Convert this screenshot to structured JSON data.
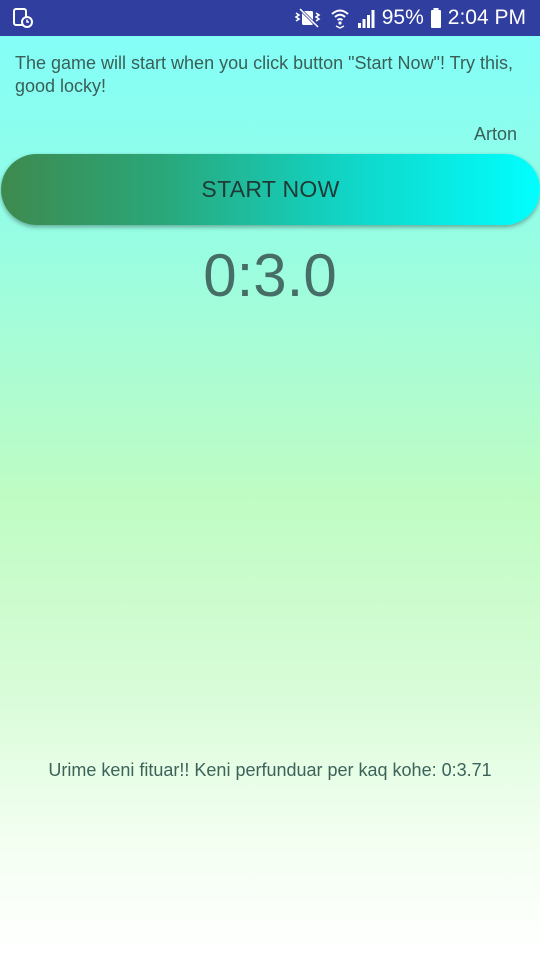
{
  "status_bar": {
    "battery_percent": "95%",
    "time": "2:04 PM",
    "icons": [
      "screenshot-notification-icon",
      "mute-vibrate-icon",
      "wifi-icon",
      "signal-icon",
      "battery-icon"
    ]
  },
  "intro_text": "The game will start when you click button \"Start Now\"! Try this, good locky!",
  "author": "Arton",
  "start_button_label": "START NOW",
  "timer_display": "0:3.0",
  "result_text": "Urime keni fituar!! Keni perfunduar per kaq kohe: 0:3.71",
  "colors": {
    "status_bar": "#303f9f",
    "button_gradient_start": "#3e8a4e",
    "button_gradient_end": "#00ffff",
    "text": "#3a5f58"
  }
}
